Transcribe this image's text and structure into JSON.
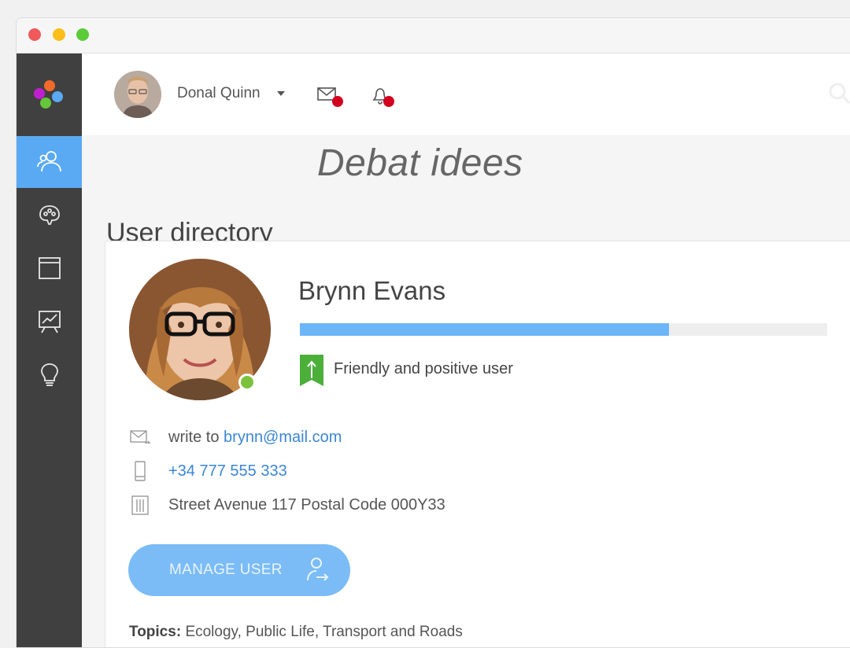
{
  "window": {
    "controls": [
      "close",
      "minimize",
      "maximize"
    ]
  },
  "sidebar": {
    "logo": "app-logo",
    "items": [
      {
        "icon": "users-icon",
        "active": true
      },
      {
        "icon": "brain-icon",
        "active": false
      },
      {
        "icon": "document-icon",
        "active": false
      },
      {
        "icon": "presentation-icon",
        "active": false
      },
      {
        "icon": "lightbulb-icon",
        "active": false
      }
    ]
  },
  "header": {
    "user_name": "Donal Quinn",
    "mail_icon": "mail-icon",
    "bell_icon": "bell-icon",
    "search_icon": "search-icon"
  },
  "overlay_title": "Debat idees",
  "page_title": "User directory",
  "profile": {
    "name": "Brynn Evans",
    "progress_fraction": 0.7,
    "badge_label": "Friendly and positive user",
    "email_prefix": "write to",
    "email": "brynn@mail.com",
    "phone": "+34 777 555 333",
    "address": "Street Avenue 117 Postal Code 000Y33",
    "manage_button": "MANAGE USER",
    "topics_label": "Topics:",
    "topics_value": "Ecology, Public Life, Transport and Roads"
  },
  "colors": {
    "accent": "#5aa9f3",
    "sidebar_bg": "#404040",
    "notification_dot": "#d2001f",
    "online": "#7cc13b",
    "badge": "#4caf3a"
  }
}
